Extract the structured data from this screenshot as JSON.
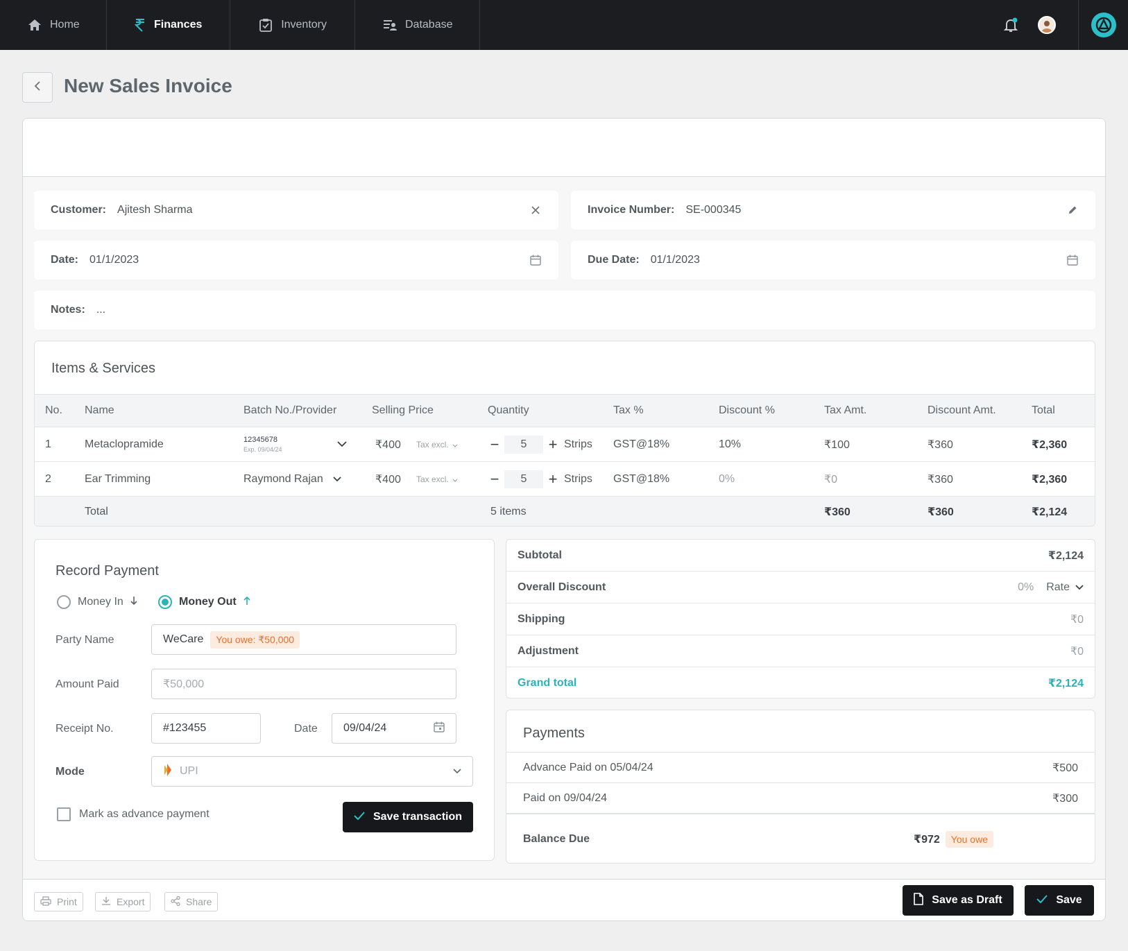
{
  "nav": {
    "items": [
      {
        "label": "Home",
        "icon": "home-icon"
      },
      {
        "label": "Finances",
        "icon": "rupee-icon"
      },
      {
        "label": "Inventory",
        "icon": "clipboard-icon"
      },
      {
        "label": "Database",
        "icon": "database-icon"
      }
    ],
    "active": "Finances",
    "accent": "#2bc0c9"
  },
  "page": {
    "title": "New Sales Invoice"
  },
  "form": {
    "customer_label": "Customer:",
    "customer_value": "Ajitesh Sharma",
    "invoice_label": "Invoice Number:",
    "invoice_value": "SE-000345",
    "date_label": "Date:",
    "date_value": "01/1/2023",
    "due_label": "Due Date:",
    "due_value": "01/1/2023",
    "notes_label": "Notes:",
    "notes_value": "..."
  },
  "items": {
    "title": "Items & Services",
    "columns": [
      "No.",
      "Name",
      "Batch No./Provider",
      "Selling Price",
      "Quantity",
      "Tax %",
      "Discount %",
      "Tax Amt.",
      "Discount Amt.",
      "Total"
    ],
    "rows": [
      {
        "no": "1",
        "name": "Metaclopramide",
        "batch": "12345678",
        "batch_exp": "Exp. 09/04/24",
        "price": "₹400",
        "tax_mode": "Tax excl.",
        "qty": "5",
        "unit": "Strips",
        "tax": "GST@18%",
        "discount": "10%",
        "tax_amt": "₹100",
        "discount_amt": "₹360",
        "total": "₹2,360"
      },
      {
        "no": "2",
        "name": "Ear Trimming",
        "provider": "Raymond Rajan",
        "price": "₹400",
        "tax_mode": "Tax excl.",
        "qty": "5",
        "unit": "Strips",
        "tax": "GST@18%",
        "discount": "0%",
        "tax_amt": "₹0",
        "discount_amt": "₹360",
        "total": "₹2,360"
      }
    ],
    "footer": {
      "label": "Total",
      "qty": "5 items",
      "tax_amt": "₹360",
      "discount_amt": "₹360",
      "total": "₹2,124"
    }
  },
  "payment": {
    "title": "Record Payment",
    "money_in": "Money In",
    "money_out": "Money Out",
    "selected": "Money Out",
    "party_label": "Party Name",
    "party_value": "WeCare",
    "party_badge": "You owe: ₹50,000",
    "amount_label": "Amount Paid",
    "amount_placeholder": "₹50,000",
    "receipt_label": "Receipt No.",
    "receipt_value": "#123455",
    "date_label": "Date",
    "date_value": "09/04/24",
    "mode_label": "Mode",
    "mode_value": "UPI",
    "advance_label": "Mark as advance payment",
    "save_label": "Save transaction"
  },
  "summary": {
    "subtotal_label": "Subtotal",
    "subtotal_value": "₹2,124",
    "discount_label": "Overall Discount",
    "discount_value": "0%",
    "discount_type": "Rate",
    "shipping_label": "Shipping",
    "shipping_value": "₹0",
    "adjustment_label": "Adjustment",
    "adjustment_value": "₹0",
    "grand_label": "Grand total",
    "grand_value": "₹2,124"
  },
  "payments": {
    "title": "Payments",
    "rows": [
      {
        "label": "Advance Paid on 05/04/24",
        "value": "₹500"
      },
      {
        "label": "Paid on 09/04/24",
        "value": "₹300"
      }
    ],
    "balance_label": "Balance Due",
    "balance_value": "₹972",
    "balance_badge": "You owe"
  },
  "footer": {
    "print": "Print",
    "export": "Export",
    "share": "Share",
    "draft": "Save as Draft",
    "save": "Save"
  }
}
